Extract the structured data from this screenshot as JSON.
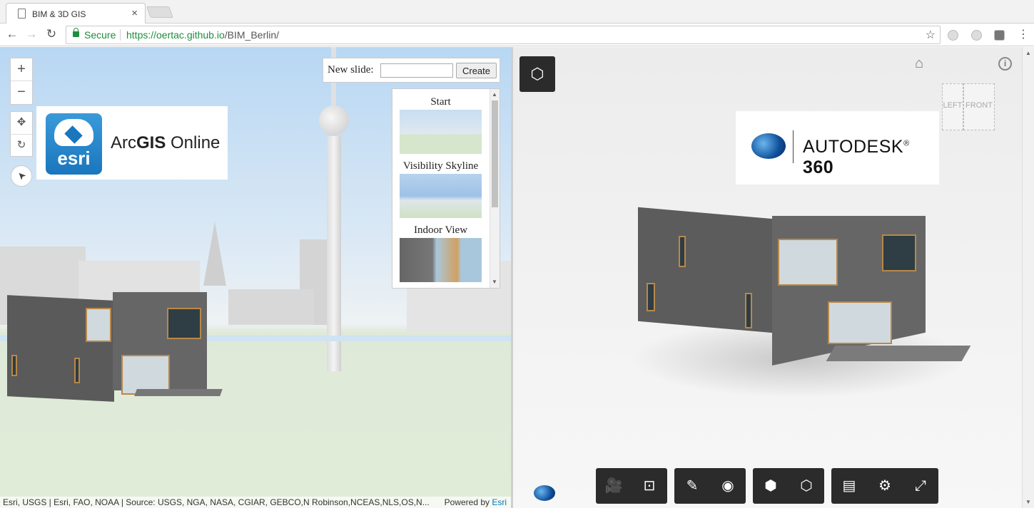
{
  "browser": {
    "tab_title": "BIM & 3D GIS",
    "tab_close": "×",
    "security_label": "Secure",
    "url_scheme_host": "https://oertac.github.io",
    "url_path": "/BIM_Berlin/",
    "icons": [
      "back-icon",
      "forward-icon",
      "reload-icon",
      "lock-icon",
      "star-icon"
    ]
  },
  "gis": {
    "zoom_in": "+",
    "zoom_out": "−",
    "pan": "✥",
    "rotate": "↻",
    "compass": "➤",
    "logo_esri": "esri",
    "logo_arc": "Arc",
    "logo_gis": "GIS",
    "logo_online": " Online",
    "new_slide_label": "New slide:",
    "new_slide_value": "",
    "create_button": "Create",
    "slides": [
      {
        "title": "Start"
      },
      {
        "title": "Visibility Skyline"
      },
      {
        "title": "Indoor View"
      }
    ],
    "attribution": "Esri, USGS | Esri, FAO, NOAA | Source: USGS, NGA, NASA, CGIAR, GEBCO,N Robinson,NCEAS,NLS,OS,N...",
    "powered_by": "Powered by ",
    "powered_by_link": "Esri"
  },
  "viewer": {
    "home": "⌂",
    "info": "i",
    "viewcube_left": "LEFT",
    "viewcube_front": "FRONT",
    "logo_autodesk": "AUTODESK",
    "logo_reg": "®",
    "logo_360": "360",
    "toolbar": [
      {
        "icon": "camera-icon",
        "glyph": "🎥"
      },
      {
        "icon": "focus-icon",
        "glyph": "⊡"
      },
      {
        "icon": "measure-icon",
        "glyph": "✎"
      },
      {
        "icon": "hide-icon",
        "glyph": "◉"
      },
      {
        "icon": "explode-icon",
        "glyph": "⬢"
      },
      {
        "icon": "section-icon",
        "glyph": "⬡"
      },
      {
        "icon": "properties-icon",
        "glyph": "▤"
      },
      {
        "icon": "settings-icon",
        "glyph": "⚙"
      },
      {
        "icon": "fullscreen-icon",
        "glyph": "⤢"
      }
    ]
  },
  "colors": {
    "secure_green": "#1e8e3e",
    "esri_blue": "#0079c1",
    "toolbar_dark": "#2b2b2b"
  }
}
